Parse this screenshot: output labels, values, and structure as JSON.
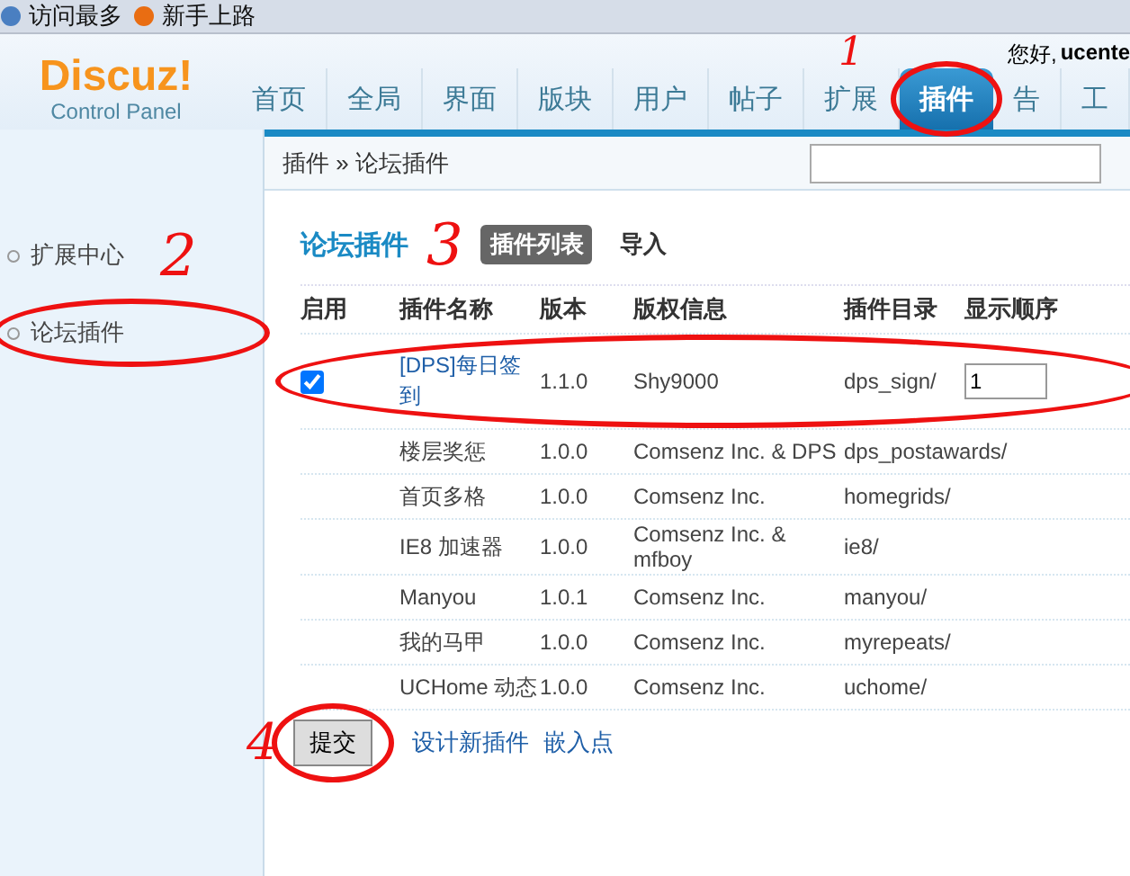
{
  "bookmarks": [
    {
      "label": "访问最多"
    },
    {
      "label": "新手上路"
    }
  ],
  "logo": {
    "title": "Discuz!",
    "subtitle": "Control Panel"
  },
  "nav": [
    {
      "label": "首页",
      "selected": false
    },
    {
      "label": "全局",
      "selected": false
    },
    {
      "label": "界面",
      "selected": false
    },
    {
      "label": "版块",
      "selected": false
    },
    {
      "label": "用户",
      "selected": false
    },
    {
      "label": "帖子",
      "selected": false
    },
    {
      "label": "扩展",
      "selected": false
    },
    {
      "label": "插件",
      "selected": true
    },
    {
      "label": "告",
      "selected": false
    },
    {
      "label": "工",
      "selected": false
    }
  ],
  "greeting": "您好,",
  "username": "ucente",
  "breadcrumb": "插件 » 论坛插件",
  "sidebar": [
    {
      "label": "扩展中心"
    },
    {
      "label": "论坛插件"
    }
  ],
  "page_title": "论坛插件",
  "tabs": [
    {
      "label": "插件列表",
      "selected": true
    },
    {
      "label": "导入",
      "selected": false
    }
  ],
  "table": {
    "columns": [
      "启用",
      "插件名称",
      "版本",
      "版权信息",
      "插件目录",
      "显示顺序"
    ],
    "rows": [
      {
        "kind": "enabled",
        "checked": true,
        "name": "[DPS]每日签到",
        "version": "1.1.0",
        "copyright": "Shy9000",
        "directory": "dps_sign/",
        "order": "1"
      },
      {
        "kind": "plain",
        "name": "楼层奖惩",
        "version": "1.0.0",
        "copyright": "Comsenz Inc. & DPS",
        "directory": "dps_postawards/"
      },
      {
        "kind": "plain",
        "name": "首页多格",
        "version": "1.0.0",
        "copyright": "Comsenz Inc.",
        "directory": "homegrids/"
      },
      {
        "kind": "plain",
        "name": "IE8 加速器",
        "version": "1.0.0",
        "copyright": "Comsenz Inc. & mfboy",
        "directory": "ie8/"
      },
      {
        "kind": "plain",
        "name": "Manyou",
        "version": "1.0.1",
        "copyright": "Comsenz Inc.",
        "directory": "manyou/"
      },
      {
        "kind": "plain",
        "name": "我的马甲",
        "version": "1.0.0",
        "copyright": "Comsenz Inc.",
        "directory": "myrepeats/"
      },
      {
        "kind": "plain",
        "name": "UCHome 动态",
        "version": "1.0.0",
        "copyright": "Comsenz Inc.",
        "directory": "uchome/"
      }
    ]
  },
  "submit": "提交",
  "links": [
    "设计新插件",
    "嵌入点"
  ],
  "annotations": [
    {
      "number": "1"
    },
    {
      "number": "2"
    },
    {
      "number": "3"
    },
    {
      "number": "4"
    }
  ]
}
